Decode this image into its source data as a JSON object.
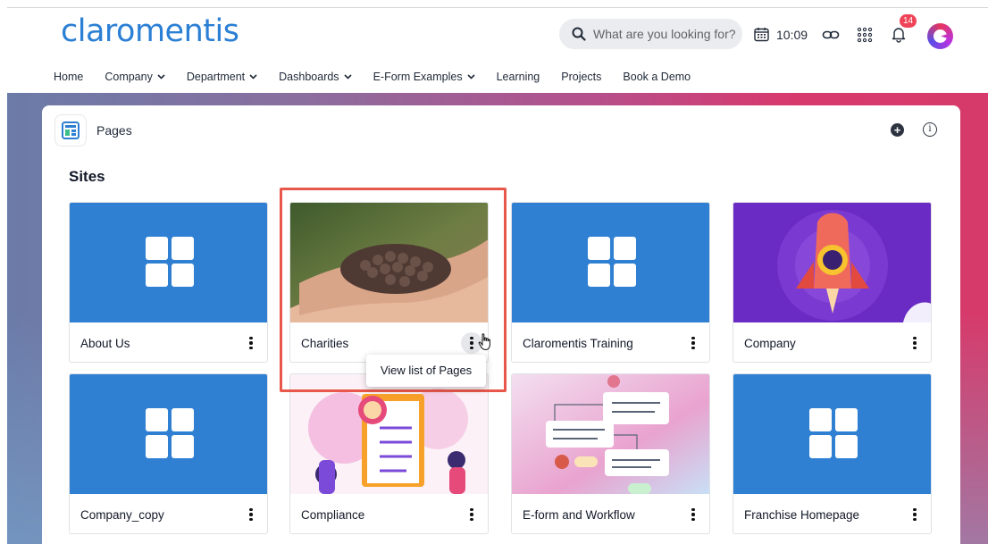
{
  "app": {
    "logo_text": "claromentis",
    "search_placeholder": "What are you looking for?",
    "clock": "10:09",
    "notification_count": "14",
    "brand_color": "#2b7fd4",
    "icons": [
      "search-icon",
      "calendar-icon",
      "link-icon",
      "apps-grid-icon",
      "bell-icon",
      "avatar"
    ]
  },
  "nav": {
    "items": [
      {
        "label": "Home",
        "dropdown": false
      },
      {
        "label": "Company",
        "dropdown": true
      },
      {
        "label": "Department",
        "dropdown": true
      },
      {
        "label": "Dashboards",
        "dropdown": true
      },
      {
        "label": "E-Form Examples",
        "dropdown": true
      },
      {
        "label": "Learning",
        "dropdown": false
      },
      {
        "label": "Projects",
        "dropdown": false
      },
      {
        "label": "Book a Demo",
        "dropdown": false
      }
    ]
  },
  "panel": {
    "title": "Pages",
    "section_heading": "Sites",
    "add_icon": "plus-icon",
    "info_icon": "info-icon"
  },
  "sites": [
    {
      "name": "About Us",
      "thumb": "blue-grid"
    },
    {
      "name": "Charities",
      "thumb": "photo-hands-seeds"
    },
    {
      "name": "Claromentis Training",
      "thumb": "blue-grid"
    },
    {
      "name": "Company",
      "thumb": "rocket-illustration"
    },
    {
      "name": "Company_copy",
      "thumb": "blue-grid"
    },
    {
      "name": "Compliance",
      "thumb": "iso-clipboard-illustration"
    },
    {
      "name": "E-form and Workflow",
      "thumb": "workflow-illustration"
    },
    {
      "name": "Franchise Homepage",
      "thumb": "blue-grid"
    }
  ],
  "tooltip": {
    "text": "View list of Pages"
  }
}
